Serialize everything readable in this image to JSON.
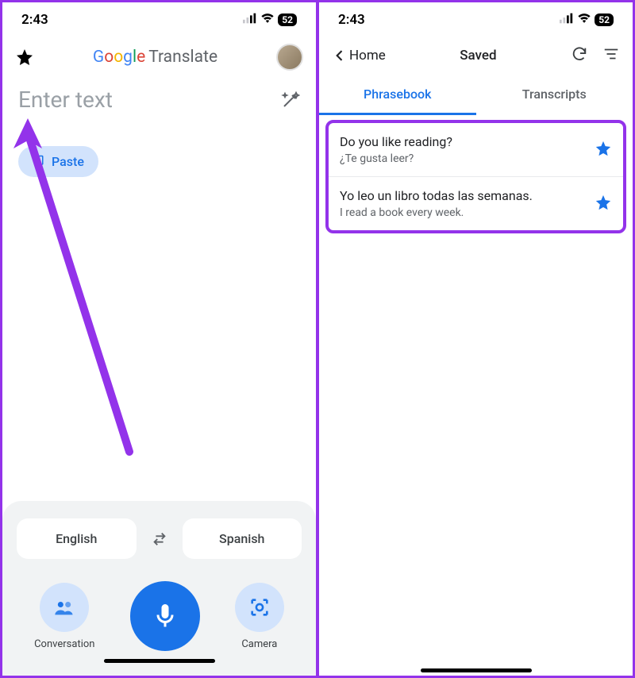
{
  "status": {
    "time": "2:43",
    "battery": "52"
  },
  "left": {
    "title_translate": "Translate",
    "enter_placeholder": "Enter text",
    "paste_label": "Paste",
    "source_lang": "English",
    "target_lang": "Spanish",
    "conversation_label": "Conversation",
    "camera_label": "Camera"
  },
  "right": {
    "back_label": "Home",
    "title": "Saved",
    "tab_phrasebook": "Phrasebook",
    "tab_transcripts": "Transcripts",
    "items": [
      {
        "main": "Do you like reading?",
        "sub": "¿Te gusta leer?"
      },
      {
        "main": "Yo leo un libro todas las semanas.",
        "sub": "I read a book every week."
      }
    ]
  }
}
